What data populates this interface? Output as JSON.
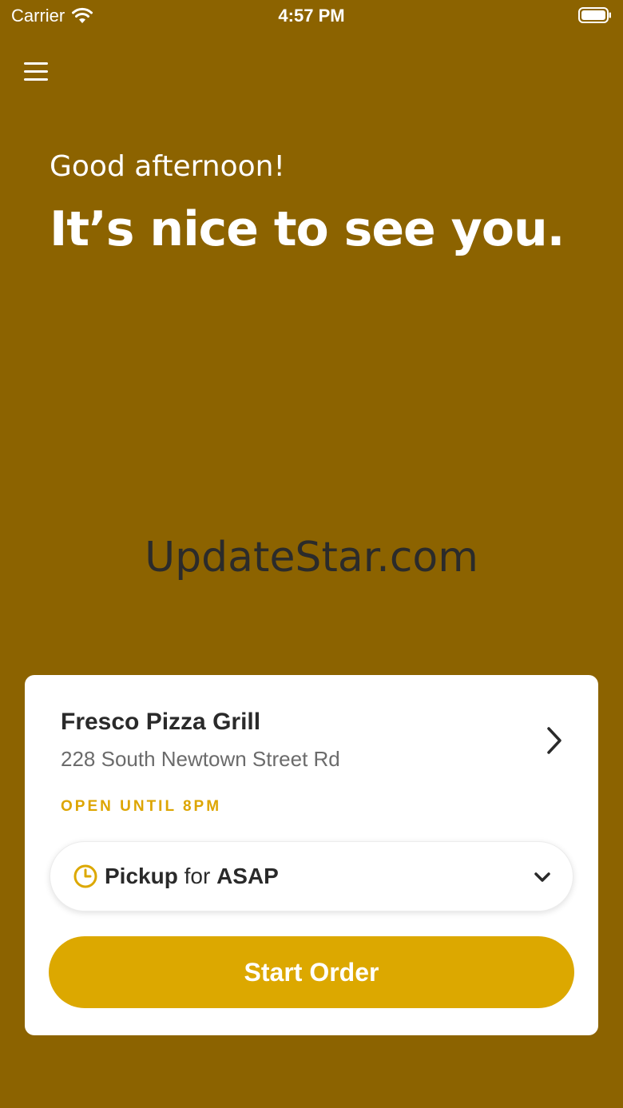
{
  "status_bar": {
    "carrier": "Carrier",
    "time": "4:57 PM"
  },
  "header": {
    "menu_icon": "hamburger-menu-icon"
  },
  "greeting": {
    "line1": "Good afternoon!",
    "line2": "It’s nice to see you."
  },
  "watermark": "UpdateStar.com",
  "store_card": {
    "name": "Fresco Pizza Grill",
    "address": "228 South Newtown Street Rd",
    "open_status": "OPEN UNTIL 8PM",
    "pickup": {
      "mode": "Pickup",
      "connector": "for",
      "time": "ASAP"
    },
    "start_label": "Start Order"
  },
  "colors": {
    "background": "#8c6300",
    "accent": "#dca800",
    "card": "#ffffff",
    "text_dark": "#2a2a2a"
  }
}
